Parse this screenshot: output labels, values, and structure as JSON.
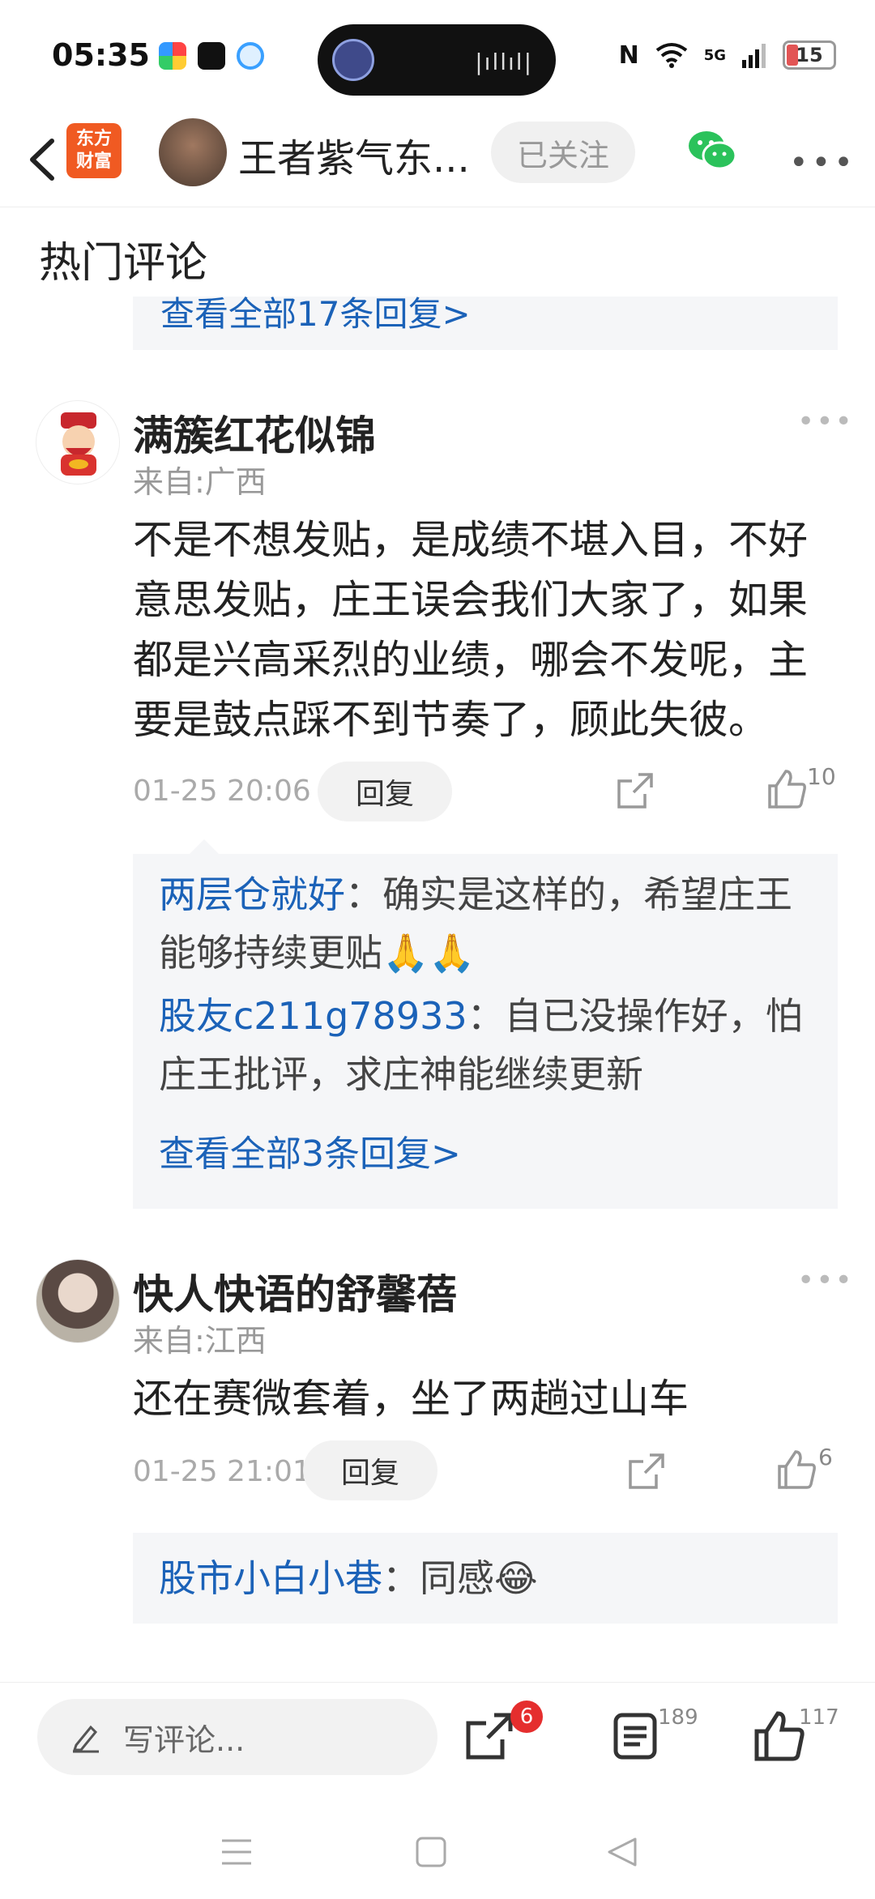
{
  "status_bar": {
    "time": "05:35",
    "network": "5G",
    "battery": "15"
  },
  "header": {
    "logo_text_line1": "东方",
    "logo_text_line2": "财富",
    "author_name": "王者紫气东...",
    "follow_label": "已关注"
  },
  "section_title": "热门评论",
  "top_partial_reply": "查看全部17条回复>",
  "comments": [
    {
      "name": "满簇红花似锦",
      "from": "来自:广西",
      "text": "不是不想发贴，是成绩不堪入目，不好意思发贴，庄王误会我们大家了，如果都是兴高采烈的业绩，哪会不发呢，主要是鼓点踩不到节奏了，顾此失彼。",
      "time": "01-25 20:06",
      "reply_label": "回复",
      "likes": "10",
      "replies": [
        {
          "user": "两层仓就好",
          "text": "：确实是这样的，希望庄王能够持续更贴🙏🙏"
        },
        {
          "user": "股友c211g78933",
          "text": "：自已没操作好，怕庄王批评，求庄神能继续更新"
        }
      ],
      "view_all": "查看全部3条回复>"
    },
    {
      "name": "快人快语的舒馨蓓",
      "from": "来自:江西",
      "text": "还在赛微套着，坐了两趟过山车",
      "time": "01-25 21:01",
      "reply_label": "回复",
      "likes": "6",
      "replies": [
        {
          "user": "股市小白小巷",
          "text": "：同感😂"
        }
      ]
    }
  ],
  "bottom_bar": {
    "placeholder": "写评论...",
    "share_badge": "6",
    "comments_count": "189",
    "likes_count": "117"
  },
  "colors": {
    "link_blue": "#1b62b8",
    "brand_orange": "#f05a22",
    "badge_red": "#e52e2e"
  }
}
